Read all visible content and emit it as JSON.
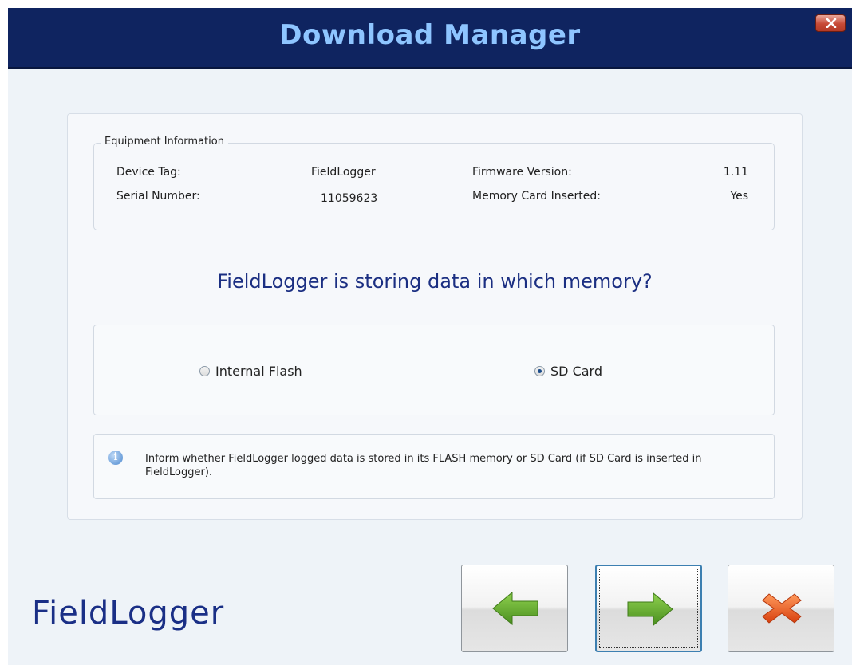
{
  "window": {
    "title": "Download Manager",
    "close_icon": "close-x-icon"
  },
  "equipment_info": {
    "legend": "Equipment Information",
    "device_tag_label": "Device Tag:",
    "device_tag_value": "FieldLogger",
    "serial_number_label": "Serial Number:",
    "serial_number_value": "11059623",
    "firmware_version_label": "Firmware Version:",
    "firmware_version_value": "1.11",
    "memory_card_label": "Memory Card Inserted:",
    "memory_card_value": "Yes"
  },
  "question": "FieldLogger is storing data in which memory?",
  "memory_options": [
    {
      "label": "Internal Flash",
      "checked": false
    },
    {
      "label": "SD Card",
      "checked": true
    }
  ],
  "hint": {
    "icon": "info-icon",
    "text": "Inform whether FieldLogger logged data is stored in its FLASH memory or SD Card (if SD Card is inserted in FieldLogger)."
  },
  "logo_text": "FieldLogger",
  "buttons": {
    "back_icon": "left-arrow-icon",
    "next_icon": "right-arrow-icon",
    "cancel_icon": "cancel-x-icon"
  },
  "colors": {
    "titlebar": "#0f2460",
    "title_text": "#8ec5ff",
    "question_text": "#1b2f82",
    "arrow_green": "#5ea82a",
    "cancel_orange": "#e8541c"
  }
}
